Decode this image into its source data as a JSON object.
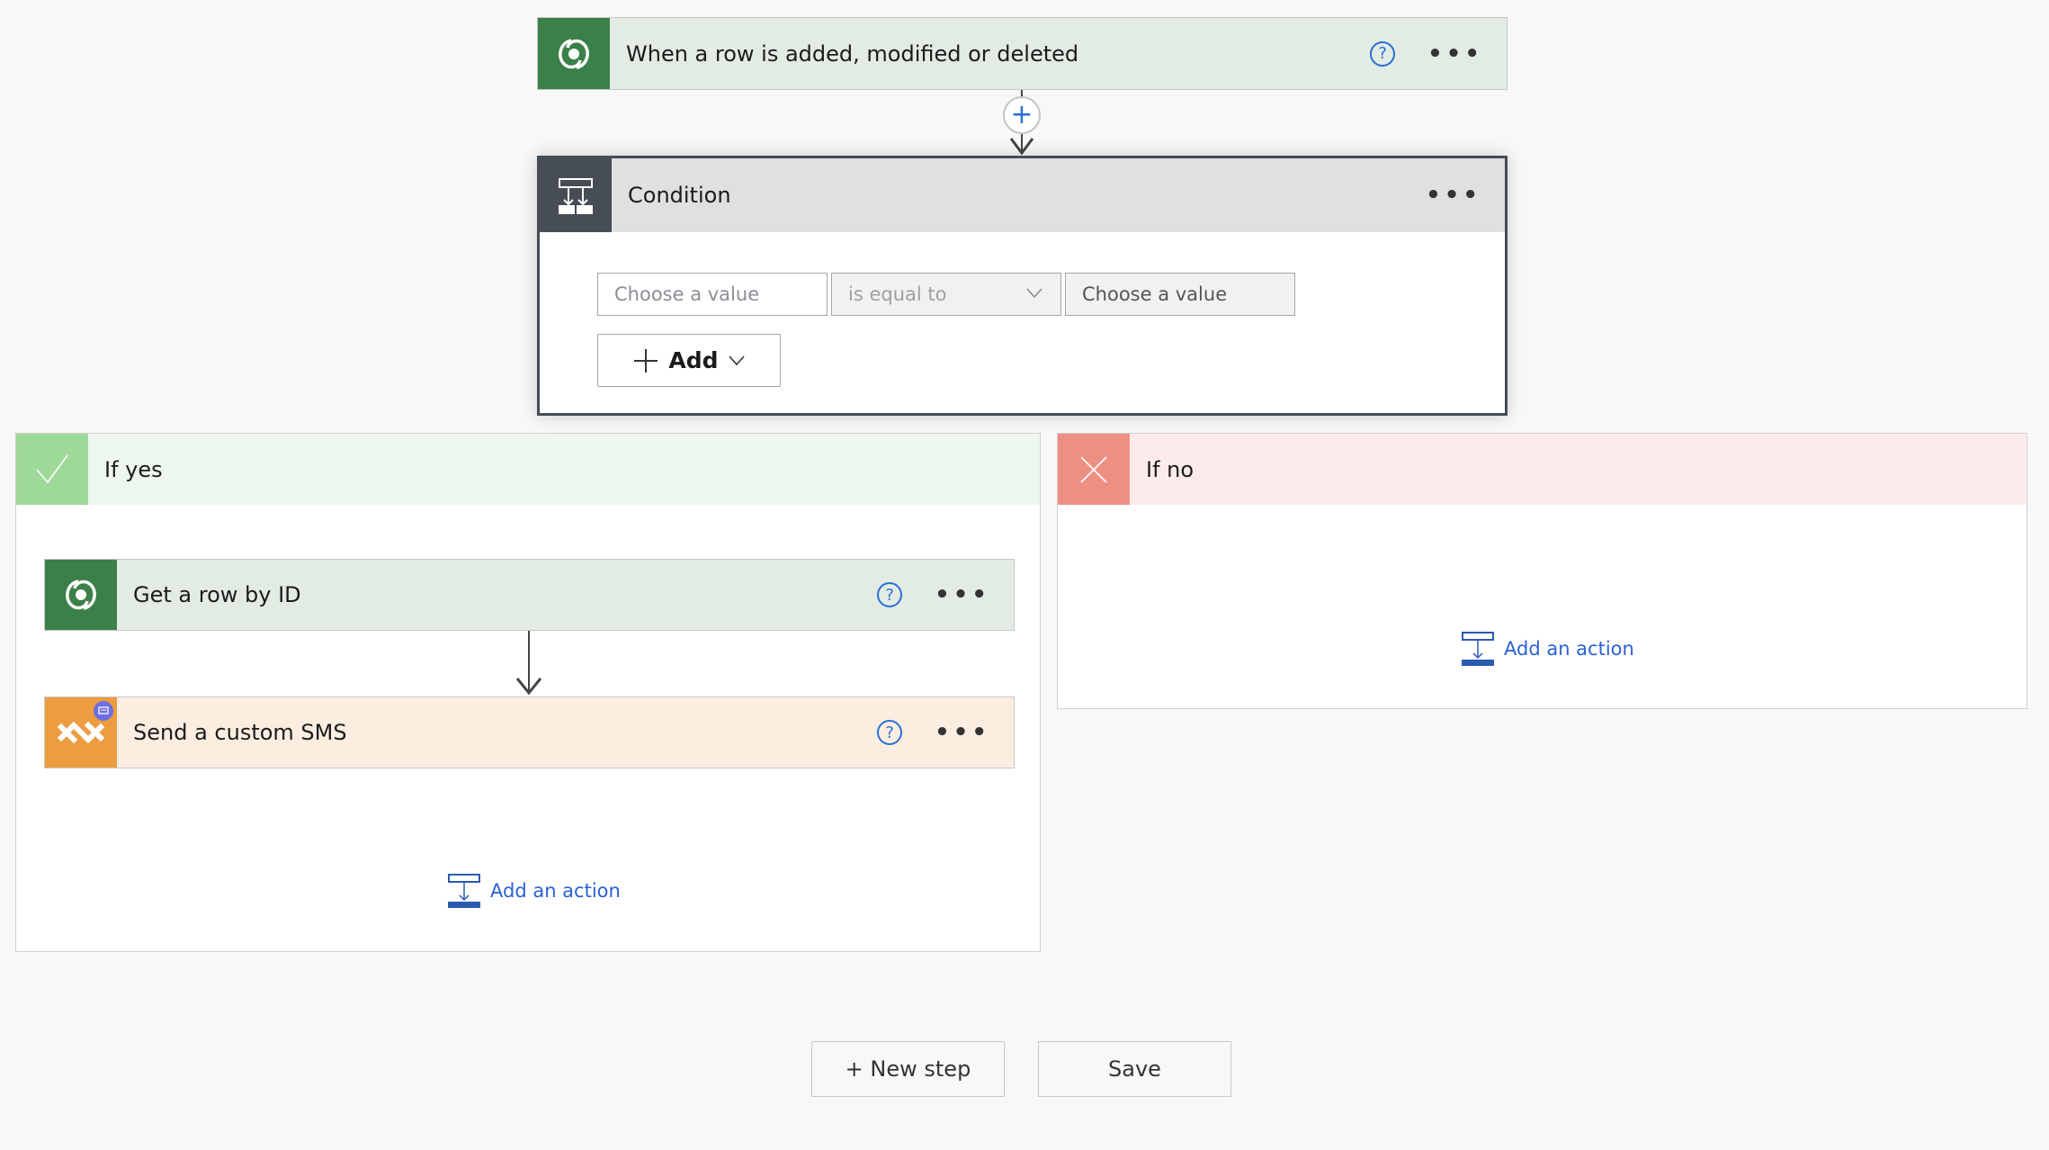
{
  "trigger": {
    "title": "When a row is added, modified or deleted",
    "help_icon": "?",
    "more_icon": "•••"
  },
  "connector": {
    "insert_icon": "+"
  },
  "condition": {
    "title": "Condition",
    "more_icon": "•••",
    "left_value_placeholder": "Choose a value",
    "operator": "is equal to",
    "right_value_placeholder": "Choose a value",
    "add_label": "Add"
  },
  "if_yes": {
    "title": "If yes",
    "actions": [
      {
        "title": "Get a row by ID",
        "help_icon": "?",
        "more_icon": "•••"
      },
      {
        "title": "Send a custom SMS",
        "help_icon": "?",
        "more_icon": "•••"
      }
    ],
    "add_action_label": "Add an action"
  },
  "if_no": {
    "title": "If no",
    "add_action_label": "Add an action"
  },
  "footer": {
    "new_step_label": "+ New step",
    "save_label": "Save"
  },
  "colors": {
    "dataverse_green": "#3a8048",
    "condition_dark": "#474d55",
    "yes_green": "#9fd99a",
    "no_red": "#ee8f84",
    "sms_orange": "#eb9d40",
    "link_blue": "#2b62d2"
  }
}
